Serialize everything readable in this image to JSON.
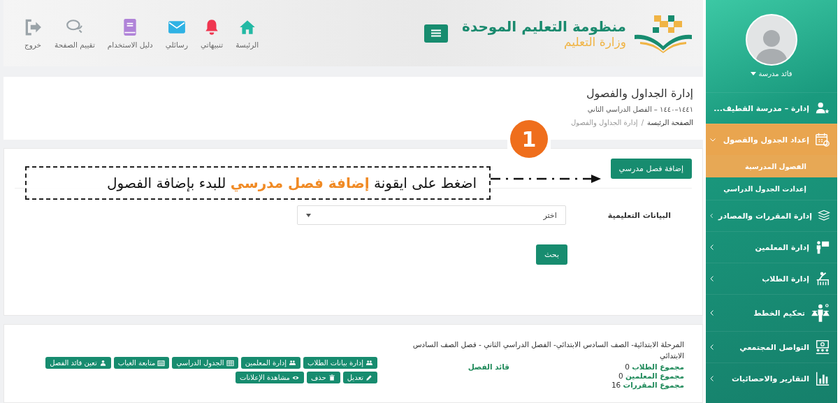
{
  "header": {
    "title": "منظومة التعليم الموحدة",
    "subtitle": "وزارة التعليم",
    "nav": [
      {
        "label": "الرئيسة"
      },
      {
        "label": "تنبيهاتي"
      },
      {
        "label": "رسائلي"
      },
      {
        "label": "دليل الاستخدام"
      },
      {
        "label": "تقييم الصفحة"
      },
      {
        "label": "خروج"
      }
    ]
  },
  "sidebar": {
    "user_name": "قائد مدرسة",
    "items": [
      {
        "kind": "link",
        "label": "إدارة – مدرسة القطيف...",
        "selected": false
      },
      {
        "kind": "group",
        "label": "إعداد الجدول والفصول",
        "selected": true,
        "expanded": true,
        "children": [
          {
            "label": "الفصول المدرسية",
            "selected": true
          },
          {
            "label": "إعدادت الجدول الدراسي",
            "selected": false
          }
        ]
      },
      {
        "kind": "group",
        "label": "إدارة المقررات والمصادر",
        "selected": false,
        "expanded": false
      },
      {
        "kind": "group",
        "label": "إدارة المعلمين",
        "selected": false,
        "expanded": false
      },
      {
        "kind": "group",
        "label": "إدارة الطلاب",
        "selected": false,
        "expanded": false
      },
      {
        "kind": "group",
        "label": "تحكيم الخطط",
        "selected": false,
        "expanded": false
      },
      {
        "kind": "group",
        "label": "التواصل المجتمعي",
        "selected": false,
        "expanded": false
      },
      {
        "kind": "group",
        "label": "التقارير والاحصائيات",
        "selected": false,
        "expanded": false
      }
    ]
  },
  "page_header": {
    "title": "إدارة الجداول والفصول",
    "term": "١٤٤١–١٤٤٠ – الفصل الدراسي الثاني",
    "breadcrumb": [
      "الصفحة الرئيسة",
      "إدارة الجداول والفصول"
    ],
    "breadcrumb_separator": "/"
  },
  "annotation": {
    "step": "1",
    "text": "اضغط على ايقونة **إضافة فصل مدرسي** للبدء بإضافة الفصول"
  },
  "search_form": {
    "add_button": "إضافة فصل مدرسي",
    "field_label": "البيانات التعليمية",
    "select_value": "اختر",
    "search_button": "بحث"
  },
  "class_card": {
    "title": "المرحلة الابتدائية- الصف السادس الابتدائي- الفصل الدراسي الثاني - فصل الصف السادس الابتدائي",
    "stats": [
      {
        "label": "مجموع الطلاب",
        "value": "0"
      },
      {
        "label": "مجموع المعلمين",
        "value": "0"
      },
      {
        "label": "مجموع المقررات",
        "value": "16"
      }
    ],
    "leader_label": "قائد الفصل",
    "actions": [
      {
        "label": "إدارة بيانات الطلاب"
      },
      {
        "label": "إدارة المعلمين"
      },
      {
        "label": "الجدول الدراسي"
      },
      {
        "label": "متابعة الغياب"
      },
      {
        "label": "تعين قائد الفصل"
      },
      {
        "label": "تعديل"
      },
      {
        "label": "حذف"
      },
      {
        "label": "مشاهدة الإعلانات"
      }
    ]
  }
}
